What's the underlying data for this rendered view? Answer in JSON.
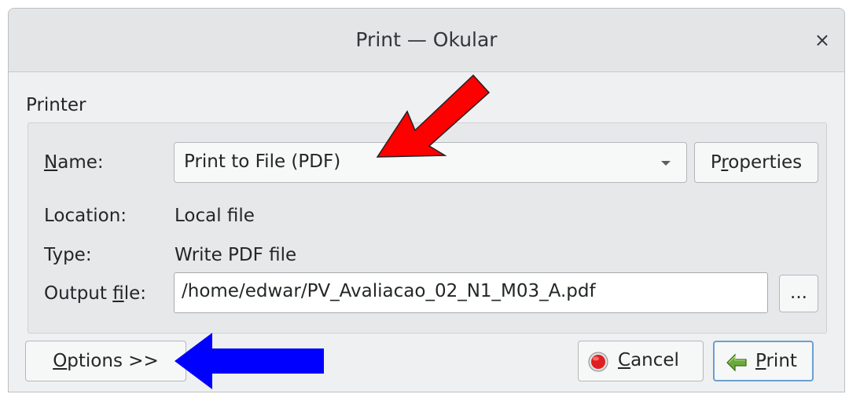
{
  "window": {
    "title": "Print — Okular",
    "close_symbol": "×"
  },
  "printer_group": {
    "title": "Printer",
    "name": {
      "label_accel": "N",
      "label_rest": "ame:",
      "value": "Print to File (PDF)"
    },
    "properties_button": {
      "pre": "P",
      "accel": "r",
      "post": "operties"
    },
    "location": {
      "label": "Location:",
      "value": "Local file"
    },
    "type": {
      "label": "Type:",
      "value": "Write PDF file"
    },
    "output_file": {
      "label_pre": "Output ",
      "label_accel": "f",
      "label_post": "ile:",
      "value": "/home/edwar/PV_Avaliacao_02_N1_M03_A.pdf"
    },
    "browse_button": {
      "label": "..."
    }
  },
  "footer": {
    "options_button": {
      "accel": "O",
      "rest": "ptions >>"
    },
    "cancel_button": {
      "accel": "C",
      "rest": "ancel"
    },
    "print_button": {
      "accel": "P",
      "rest": "rint"
    }
  },
  "annotations": {
    "red_arrow_color": "#ff0000",
    "blue_arrow_color": "#0000ff"
  }
}
